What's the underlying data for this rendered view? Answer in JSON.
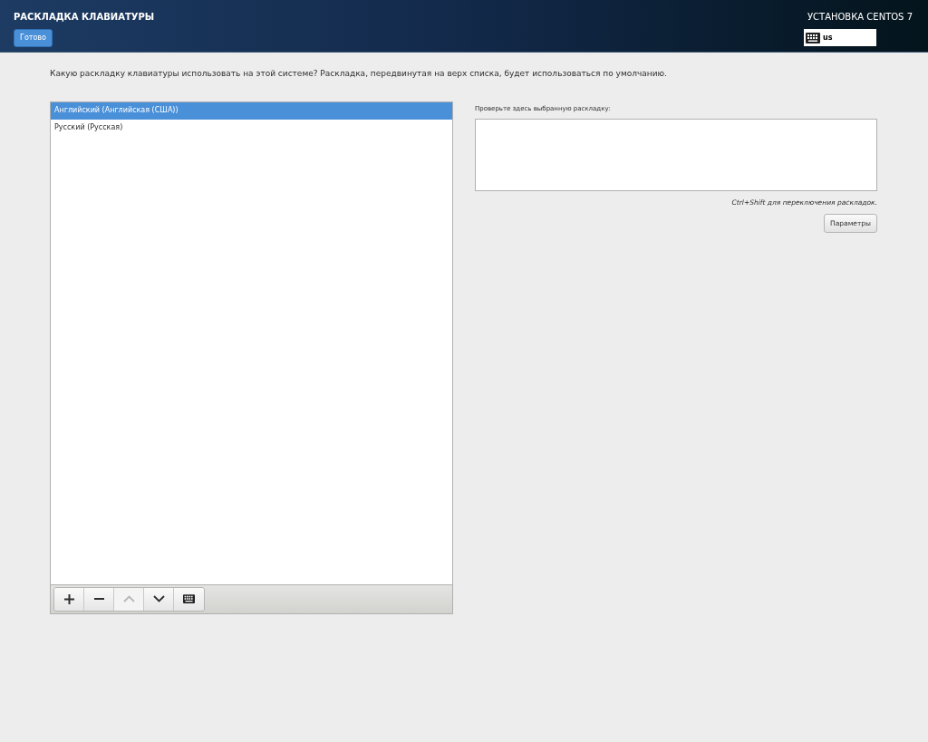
{
  "header": {
    "title": "РАСКЛАДКА КЛАВИАТУРЫ",
    "done_button": "Готово",
    "product": "УСТАНОВКА CENTOS 7",
    "layout_indicator": "us"
  },
  "description": "Какую раскладку клавиатуры использовать на этой системе? Раскладка, передвинутая на верх списка, будет использоваться по умолчанию.",
  "layouts": [
    {
      "label": "Английский (Английская (США))",
      "selected": true
    },
    {
      "label": "Русский (Русская)",
      "selected": false
    }
  ],
  "toolbar": [
    {
      "kind": "add",
      "disabled": false
    },
    {
      "kind": "remove",
      "disabled": false
    },
    {
      "kind": "up",
      "disabled": true
    },
    {
      "kind": "down",
      "disabled": false
    },
    {
      "kind": "keyboard",
      "disabled": false
    }
  ],
  "test_label": "Проверьте здесь выбранную раскладку:",
  "switch_hint": "Ctrl+Shift для переключения раскладок.",
  "options_button": "Параметры"
}
